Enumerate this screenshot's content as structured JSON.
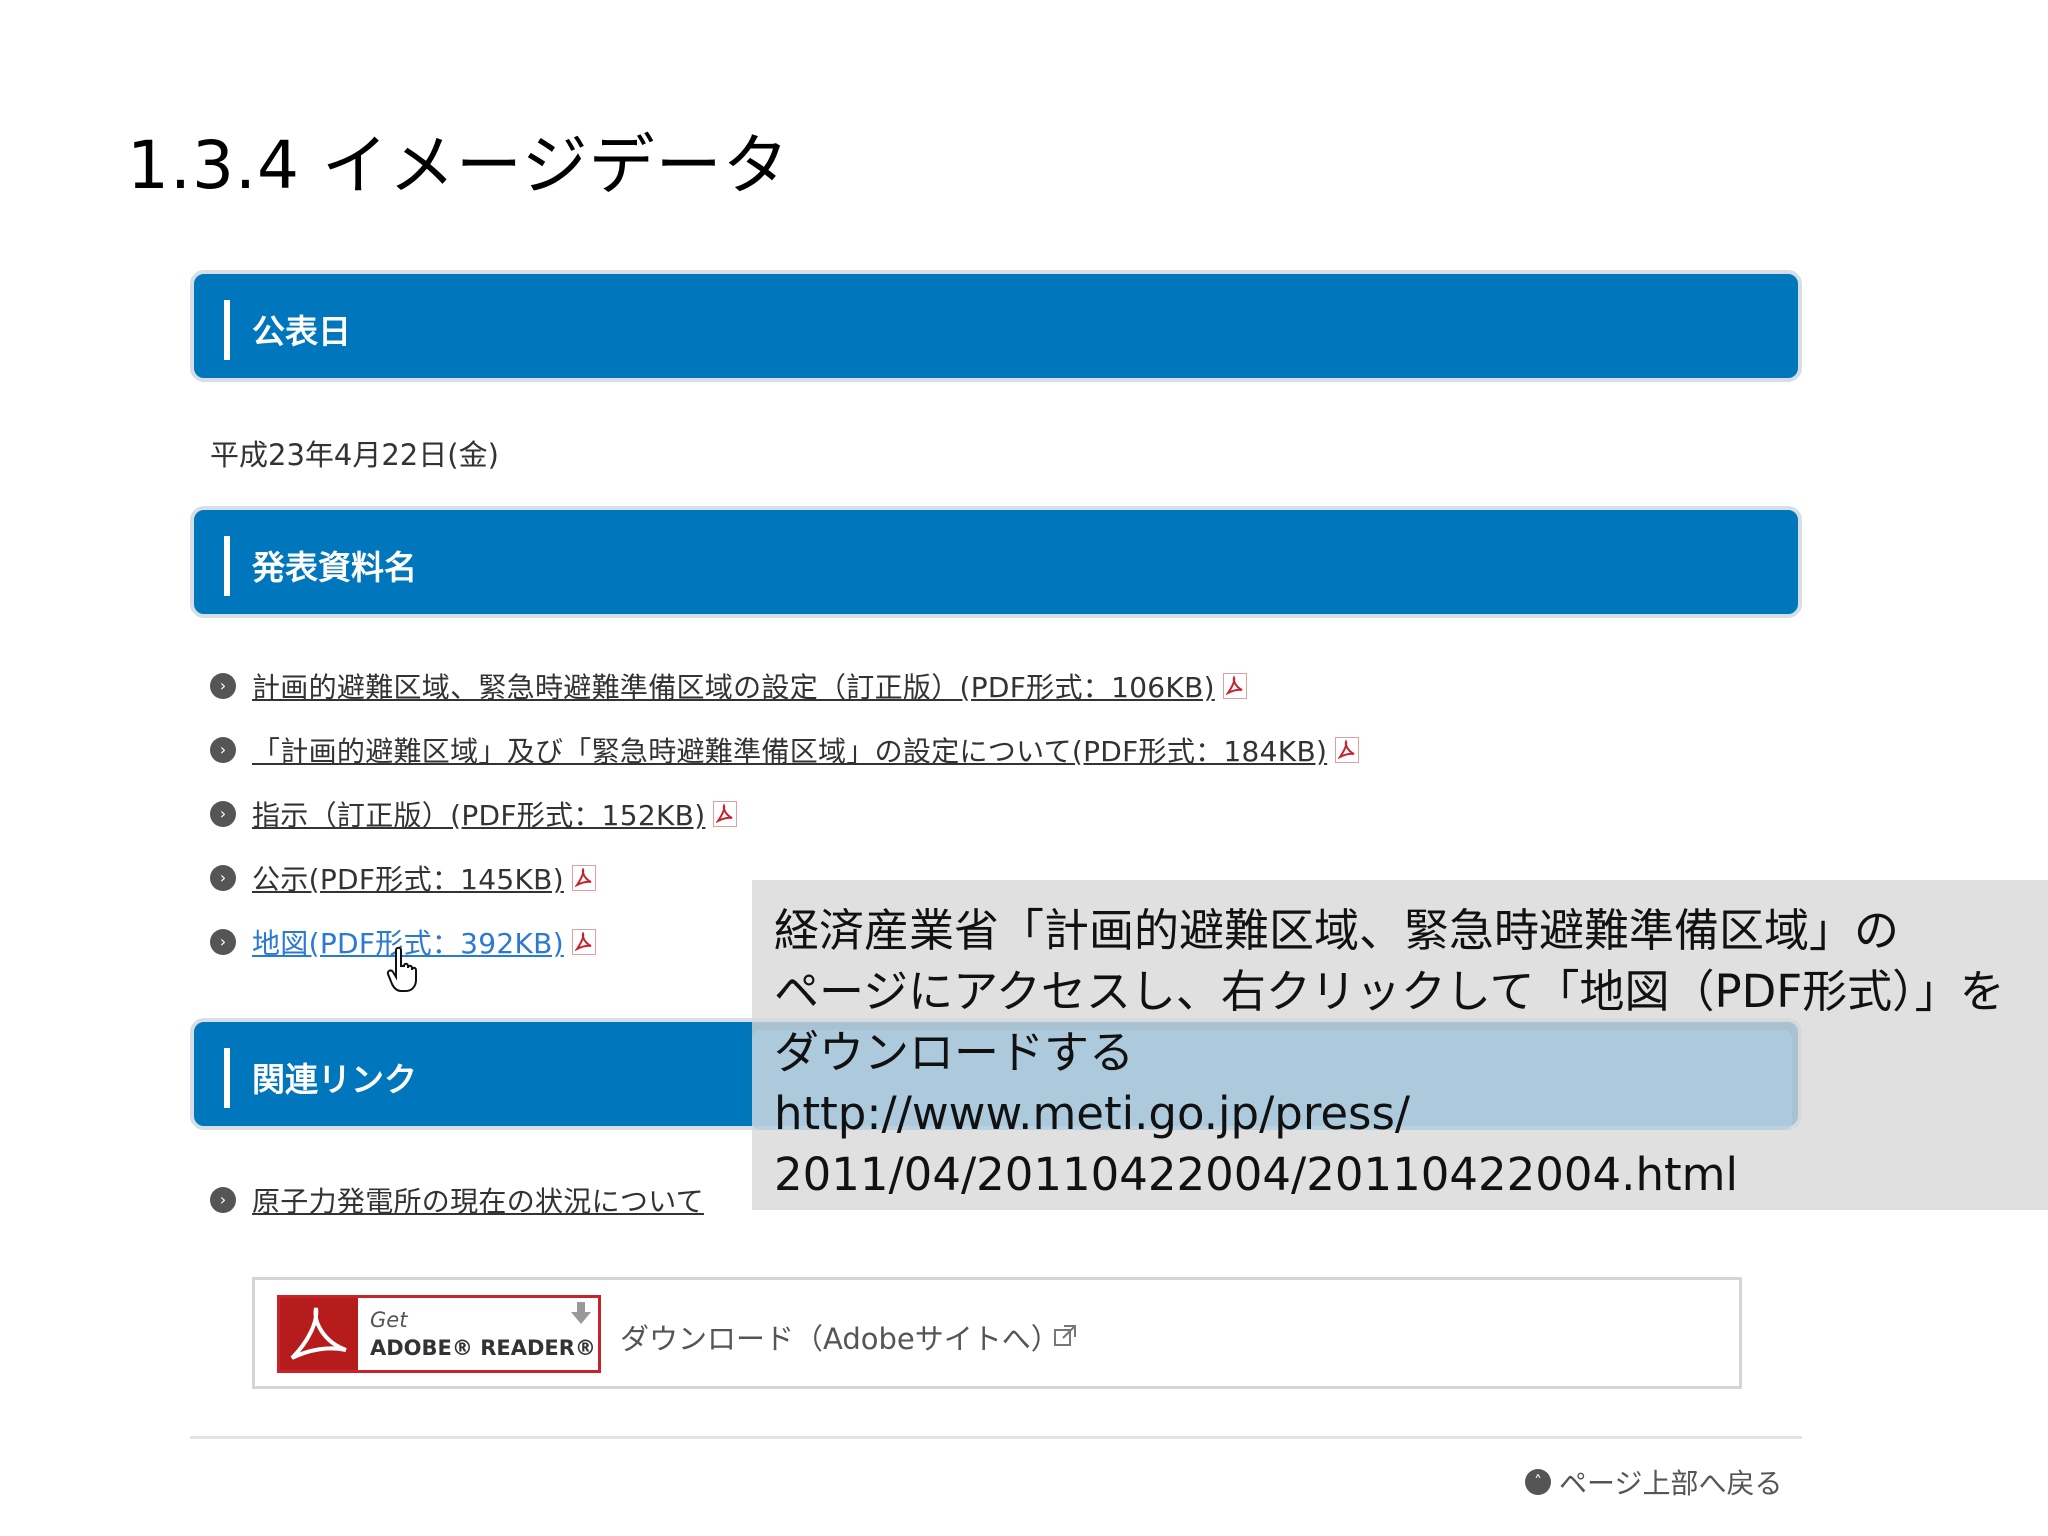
{
  "slide": {
    "title": "1.3.4 イメージデータ"
  },
  "sections": {
    "date_header": "公表日",
    "date_value": "平成23年4月22日(金)",
    "materials_header": "発表資料名",
    "related_header": "関連リンク"
  },
  "materials": [
    "計画的避難区域、緊急時避難準備区域の設定（訂正版）(PDF形式：106KB)",
    "「計画的避難区域」及び「緊急時避難準備区域」の設定について(PDF形式：184KB)",
    "指示（訂正版）(PDF形式：152KB)",
    "公示(PDF形式：145KB)",
    "地図(PDF形式：392KB)"
  ],
  "related": [
    "原子力発電所の現在の状況について"
  ],
  "adobe": {
    "get": "Get",
    "name": "ADOBE® READER®",
    "download": "ダウンロード（Adobeサイトへ）"
  },
  "footer": {
    "page_top": "ページ上部へ戻る"
  },
  "overlay": {
    "line1": "経済産業省「計画的避難区域、緊急時避難準備区域」の",
    "line2": "ページにアクセスし、右クリックして「地図（PDF形式）」を",
    "line3": "ダウンロードする",
    "line4": "http://www.meti.go.jp/press/",
    "line5": "2011/04/20110422004/20110422004.html"
  },
  "colors": {
    "section_header_bg": "#0077bd",
    "link_active": "#2a79d4",
    "pdf_icon_red": "#c8232c"
  },
  "icons": {
    "bullet": "chevron-right-icon",
    "pdf": "pdf-icon",
    "cursor": "hand-pointer-icon",
    "external": "external-link-icon",
    "page_top": "chevron-up-icon"
  }
}
